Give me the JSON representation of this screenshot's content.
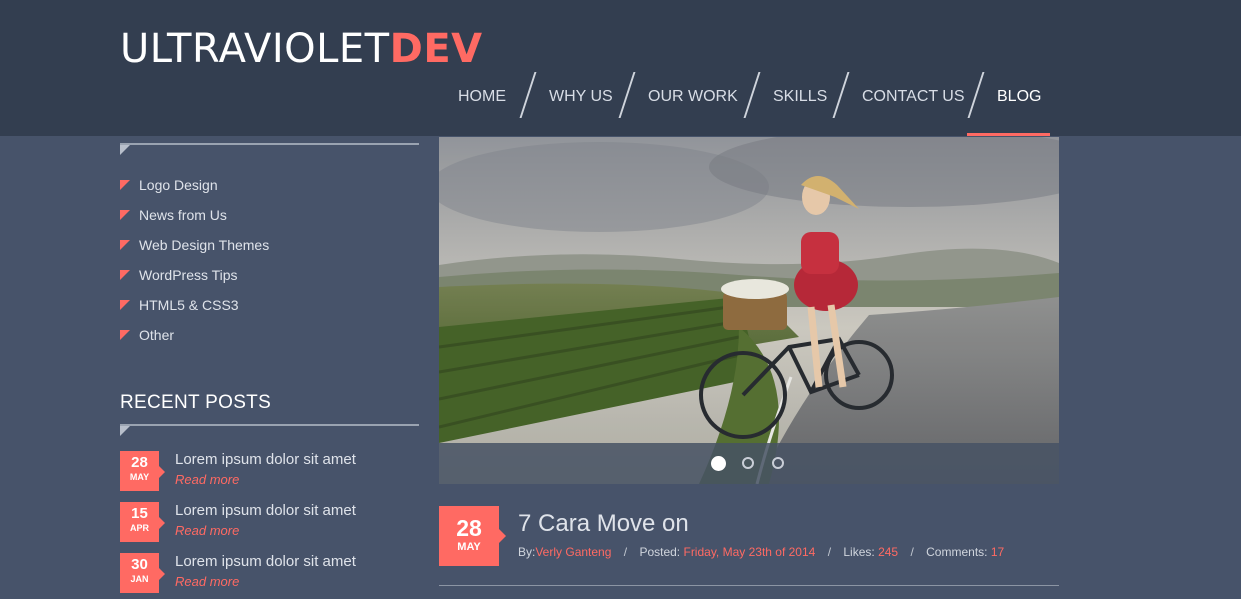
{
  "brand": {
    "part1": "ULTRAVIOLET",
    "part2": "DEV"
  },
  "nav": [
    {
      "label": "HOME"
    },
    {
      "label": "WHY US"
    },
    {
      "label": "OUR WORK"
    },
    {
      "label": "SKILLS"
    },
    {
      "label": "CONTACT US"
    },
    {
      "label": "BLOG",
      "active": true
    }
  ],
  "categories": [
    {
      "label": "Logo Design"
    },
    {
      "label": "News from Us"
    },
    {
      "label": "Web Design Themes"
    },
    {
      "label": "WordPress Tips"
    },
    {
      "label": "HTML5 & CSS3"
    },
    {
      "label": "Other"
    }
  ],
  "recent_posts": {
    "title": "RECENT POSTS",
    "items": [
      {
        "day": "28",
        "month": "MAY",
        "title": "Lorem ipsum dolor sit amet",
        "more": "Read more"
      },
      {
        "day": "15",
        "month": "APR",
        "title": "Lorem ipsum dolor sit amet",
        "more": "Read more"
      },
      {
        "day": "30",
        "month": "JAN",
        "title": "Lorem ipsum dolor sit amet",
        "more": "Read more"
      }
    ]
  },
  "slider": {
    "slide_count": 3,
    "active_slide": 1
  },
  "article": {
    "day": "28",
    "month": "MAY",
    "title": "7 Cara Move on",
    "by_label": "By:",
    "author": "Verly Ganteng",
    "posted_label": "Posted:",
    "posted": "Friday, May 23th of 2014",
    "likes_label": "Likes:",
    "likes": "245",
    "comments_label": "Comments:",
    "comments": "17"
  },
  "colors": {
    "accent": "#ff6a63",
    "header_bg": "#333e50",
    "page_bg": "#47536a"
  }
}
